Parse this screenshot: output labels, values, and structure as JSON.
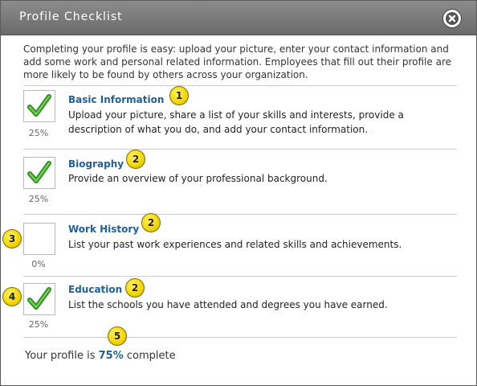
{
  "dialog": {
    "title": "Profile Checklist",
    "intro": "Completing your profile is easy: upload your picture, enter your contact information and add some work and personal related information. Employees that fill out their profile are more likely to be found by others across your organization."
  },
  "items": [
    {
      "title": "Basic Information",
      "desc": "Upload your picture, share a list of your skills and interests, provide a description of what you do, and add your contact information.",
      "percent": "25%",
      "checked": true
    },
    {
      "title": "Biography",
      "desc": "Provide an overview of your professional background.",
      "percent": "25%",
      "checked": true
    },
    {
      "title": "Work History",
      "desc": "List your past work experiences and related skills and achievements.",
      "percent": "0%",
      "checked": false
    },
    {
      "title": "Education",
      "desc": "List the schools you have attended and degrees you have earned.",
      "percent": "25%",
      "checked": true
    }
  ],
  "footer": {
    "prefix": "Your profile is",
    "value": "75%",
    "suffix": "complete"
  },
  "callouts": [
    "1",
    "2",
    "2",
    "3",
    "2",
    "4",
    "5"
  ],
  "colors": {
    "titlebar": "#7a7a7a",
    "link": "#1f5f9f",
    "check_green": "#3a9a2a",
    "callout_yellow": "#f3d400"
  },
  "icons": {
    "close": "close-icon",
    "check": "checkmark-icon"
  }
}
